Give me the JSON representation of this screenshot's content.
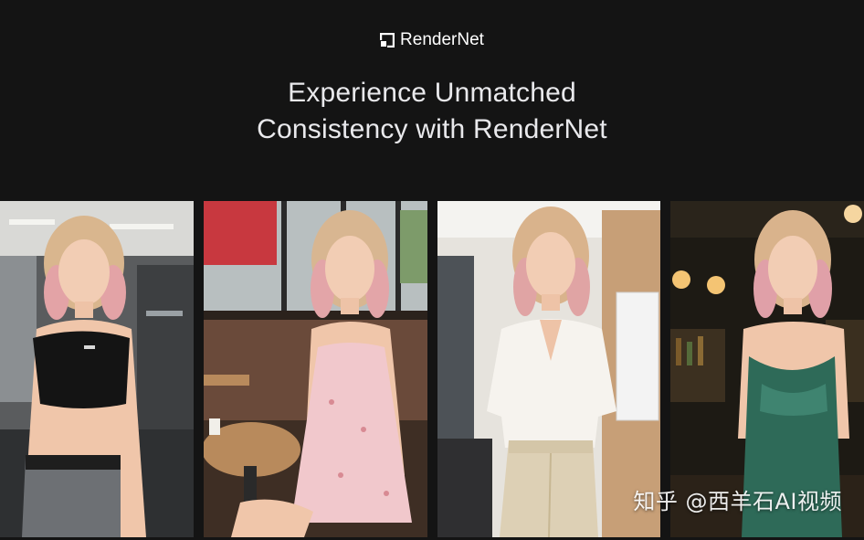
{
  "brand": {
    "name": "RenderNet",
    "icon": "rendernet-logo-icon"
  },
  "hero": {
    "title_line1": "Experience Unmatched",
    "title_line2": "Consistency with RenderNet"
  },
  "gallery": {
    "photos": [
      {
        "scene": "gym",
        "outfit": "black sports top and grey leggings"
      },
      {
        "scene": "cafe",
        "outfit": "pink floral dress"
      },
      {
        "scene": "office",
        "outfit": "white blouse and beige trousers"
      },
      {
        "scene": "bar",
        "outfit": "green satin slip dress"
      }
    ]
  },
  "watermark": {
    "text": "知乎 @西羊石AI视频"
  },
  "colors": {
    "background": "#141414",
    "title": "#e9e9ec"
  }
}
